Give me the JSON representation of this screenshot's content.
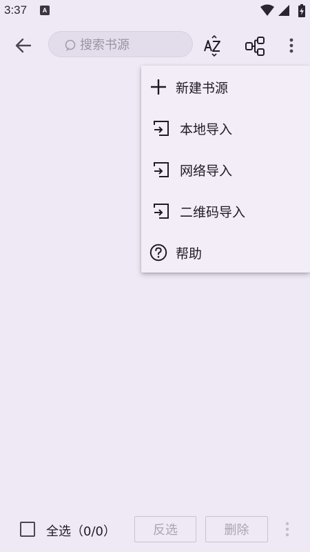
{
  "status_bar": {
    "time": "3:37",
    "notification_icon_letter": "A"
  },
  "toolbar": {
    "search_placeholder": "搜索书源",
    "icons": {
      "back": "arrow-left-icon",
      "sort": "sort-az-icon",
      "group": "group-icon",
      "more": "more-vertical-icon"
    }
  },
  "menu": {
    "items": [
      {
        "label": "新建书源",
        "icon": "plus-icon"
      },
      {
        "label": "本地导入",
        "icon": "import-icon"
      },
      {
        "label": "网络导入",
        "icon": "import-icon"
      },
      {
        "label": "二维码导入",
        "icon": "import-icon"
      },
      {
        "label": "帮助",
        "icon": "help-icon"
      }
    ]
  },
  "bottom_bar": {
    "select_all_label": "全选（0/0）",
    "invert_label": "反选",
    "delete_label": "删除"
  },
  "colors": {
    "background": "#efe9f5",
    "menu_background": "#f2edf6",
    "search_background": "#e3dcea",
    "disabled_text": "#aaa3b0"
  }
}
